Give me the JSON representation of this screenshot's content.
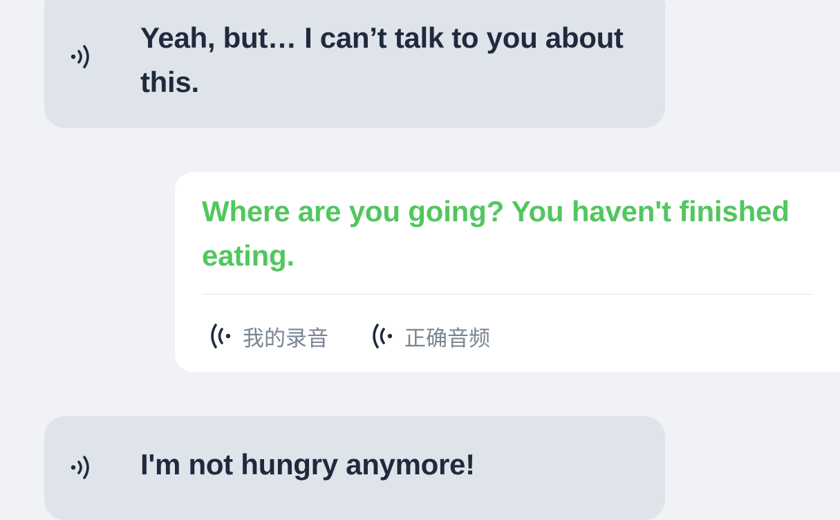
{
  "messages": {
    "top": {
      "text": "Yeah, but… I can’t talk to you about this.",
      "speaker_icon": "speaker-icon"
    },
    "card": {
      "text": "Where are you going? You haven't finished eating.",
      "text_color": "#52c65f",
      "my_recording_label": "我的录音",
      "correct_audio_label": "正确音频",
      "audio_icon": "sound-wave-icon"
    },
    "bottom": {
      "text": "I'm not hungry anymore!",
      "speaker_icon": "speaker-icon"
    }
  },
  "colors": {
    "background": "#f0f2f5",
    "bubble": "#dfe3ea",
    "card": "#ffffff",
    "text_dark": "#1f2a3d",
    "label_gray": "#7a8593"
  }
}
